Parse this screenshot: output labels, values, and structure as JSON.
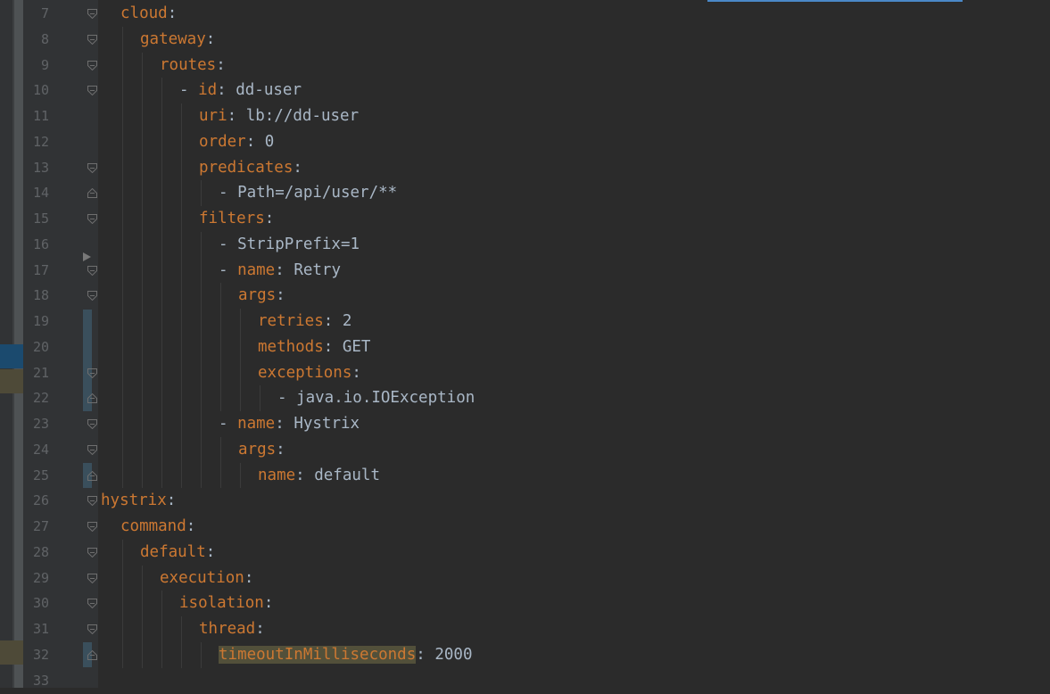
{
  "lines": [
    {
      "n": "7",
      "indent": 1,
      "key": "cloud",
      "sep": ":",
      "value": ""
    },
    {
      "n": "8",
      "indent": 2,
      "key": "gateway",
      "sep": ":",
      "value": ""
    },
    {
      "n": "9",
      "indent": 3,
      "key": "routes",
      "sep": ":",
      "value": ""
    },
    {
      "n": "10",
      "indent": 4,
      "dash": "- ",
      "key": "id",
      "sep": ": ",
      "value": "dd-user"
    },
    {
      "n": "11",
      "indent": 5,
      "key": "uri",
      "sep": ": ",
      "value": "lb://dd-user"
    },
    {
      "n": "12",
      "indent": 5,
      "key": "order",
      "sep": ": ",
      "value": "0"
    },
    {
      "n": "13",
      "indent": 5,
      "key": "predicates",
      "sep": ":",
      "value": ""
    },
    {
      "n": "14",
      "indent": 6,
      "dash": "- ",
      "key": "",
      "sep": "",
      "value": "Path=/api/user/**"
    },
    {
      "n": "15",
      "indent": 5,
      "key": "filters",
      "sep": ":",
      "value": ""
    },
    {
      "n": "16",
      "indent": 6,
      "dash": "- ",
      "key": "",
      "sep": "",
      "value": "StripPrefix=1"
    },
    {
      "n": "17",
      "indent": 6,
      "dash": "- ",
      "key": "name",
      "sep": ": ",
      "value": "Retry"
    },
    {
      "n": "18",
      "indent": 7,
      "key": "args",
      "sep": ":",
      "value": ""
    },
    {
      "n": "19",
      "indent": 8,
      "key": "retries",
      "sep": ": ",
      "value": "2"
    },
    {
      "n": "20",
      "indent": 8,
      "key": "methods",
      "sep": ": ",
      "value": "GET"
    },
    {
      "n": "21",
      "indent": 8,
      "key": "exceptions",
      "sep": ":",
      "value": ""
    },
    {
      "n": "22",
      "indent": 9,
      "dash": "- ",
      "key": "",
      "sep": "",
      "value": "java.io.IOException"
    },
    {
      "n": "23",
      "indent": 6,
      "dash": "- ",
      "key": "name",
      "sep": ": ",
      "value": "Hystrix"
    },
    {
      "n": "24",
      "indent": 7,
      "key": "args",
      "sep": ":",
      "value": ""
    },
    {
      "n": "25",
      "indent": 8,
      "key": "name",
      "sep": ": ",
      "value": "default"
    },
    {
      "n": "26",
      "indent": 0,
      "key": "hystrix",
      "sep": ":",
      "value": ""
    },
    {
      "n": "27",
      "indent": 1,
      "key": "command",
      "sep": ":",
      "value": ""
    },
    {
      "n": "28",
      "indent": 2,
      "key": "default",
      "sep": ":",
      "value": ""
    },
    {
      "n": "29",
      "indent": 3,
      "key": "execution",
      "sep": ":",
      "value": ""
    },
    {
      "n": "30",
      "indent": 4,
      "key": "isolation",
      "sep": ":",
      "value": ""
    },
    {
      "n": "31",
      "indent": 5,
      "key": "thread",
      "sep": ":",
      "value": ""
    },
    {
      "n": "32",
      "indent": 6,
      "key": "timeoutInMilliseconds",
      "sep": ": ",
      "value": "2000",
      "highlight": true
    },
    {
      "n": "33",
      "indent": 0,
      "key": "",
      "sep": "",
      "value": ""
    }
  ],
  "fold_markers": {
    "open": [
      "7",
      "8",
      "9",
      "10",
      "13",
      "15",
      "17",
      "18",
      "21",
      "23",
      "24",
      "26",
      "27",
      "28",
      "29",
      "30",
      "31"
    ],
    "close": [
      "14",
      "22",
      "25",
      "32"
    ]
  },
  "colors": {
    "background": "#2b2b2b",
    "key": "#cc7832",
    "text": "#a9b7c6",
    "line_number": "#606366",
    "highlight": "#52503a"
  }
}
